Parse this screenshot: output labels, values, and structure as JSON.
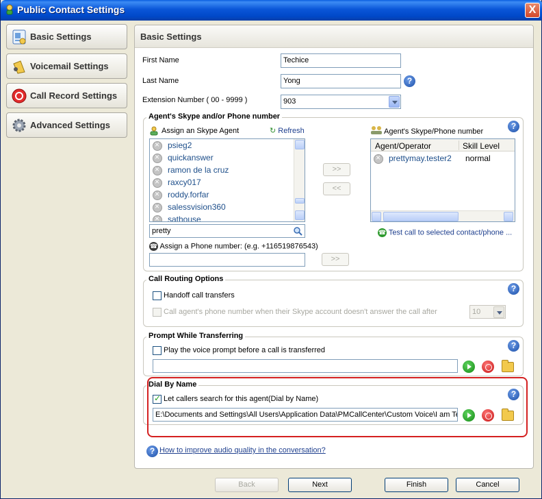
{
  "window": {
    "title": "Public Contact Settings",
    "close": "X"
  },
  "nav": [
    {
      "label": "Basic Settings",
      "icon": "settings-page-icon"
    },
    {
      "label": "Voicemail Settings",
      "icon": "voicemail-icon"
    },
    {
      "label": "Call Record Settings",
      "icon": "record-icon"
    },
    {
      "label": "Advanced Settings",
      "icon": "gear-icon"
    }
  ],
  "panel": {
    "title": "Basic Settings"
  },
  "form": {
    "first_name_label": "First Name",
    "first_name": "Techice",
    "last_name_label": "Last Name",
    "last_name": "Yong",
    "extension_label": "Extension Number ( 00 - 9999 )",
    "extension": "903"
  },
  "agents": {
    "group_title": "Agent's Skype and/or Phone number",
    "assign_skype_label": "Assign an Skype Agent",
    "refresh_label": "Refresh",
    "list": [
      "psieg2",
      "quickanswer",
      "ramon de la cruz",
      "raxcy017",
      "roddy.forfar",
      "salessvision360",
      "sathouse"
    ],
    "search_value": "pretty",
    "add_button": ">>",
    "remove_button": "<<",
    "right_title": "Agent's Skype/Phone number",
    "col_agent": "Agent/Operator",
    "col_skill": "Skill Level",
    "assigned": [
      {
        "agent": "prettymay.tester2",
        "skill": "normal"
      }
    ],
    "test_call_label": "Test call to selected contact/phone ...",
    "assign_phone_label": "Assign a Phone number: (e.g. +116519876543)",
    "phone_value": "",
    "phone_add_button": ">>"
  },
  "routing": {
    "group_title": "Call Routing Options",
    "handoff_label": "Handoff call transfers",
    "handoff_checked": false,
    "timeout_label": "Call agent's phone number when their Skype account doesn't answer the call after",
    "timeout_value": "10"
  },
  "prompt": {
    "group_title": "Prompt While Transferring",
    "play_label": "Play the voice prompt before a call is transferred",
    "play_checked": false,
    "path": ""
  },
  "dial_by_name": {
    "group_title": "Dial By Name",
    "enable_label": "Let callers search for this agent(Dial by Name)",
    "enable_checked": true,
    "path": "E:\\Documents and Settings\\All Users\\Application Data\\PMCallCenter\\Custom Voice\\I am Tech"
  },
  "help_link": "How to improve audio quality in the conversation?",
  "buttons": {
    "back": "Back",
    "next": "Next",
    "finish": "Finish",
    "cancel": "Cancel"
  },
  "colors": {
    "titlebar": "#0A56D8",
    "highlight": "#D42020",
    "link": "#1E3F8E"
  }
}
